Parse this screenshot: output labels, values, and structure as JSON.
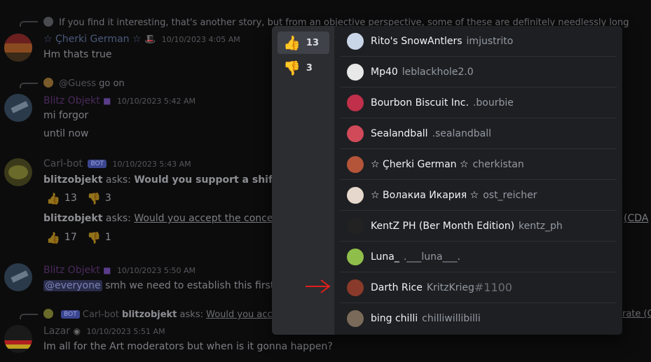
{
  "chat": {
    "top_reply": {
      "name": "",
      "text": "If you find it interesting, that's another story, but from an objective perspective, some of these are definitely needlessly long"
    },
    "msg1": {
      "name": "☆ Çherki German ☆",
      "time": "10/10/2023 4:05 AM",
      "text": "Hm thats true"
    },
    "reply2": {
      "name": "@Guess",
      "text": "go on"
    },
    "msg2": {
      "name": "Blitz Objekt",
      "time": "10/10/2023 5:42 AM",
      "line1": "mi forgor",
      "line2": "until now"
    },
    "msg3": {
      "name": "Carl-bot",
      "badge": "BOT",
      "time": "10/10/2023 5:43 AM",
      "poll1_user": "blitzobjekt",
      "poll1_asks": "asks:",
      "poll1_q": "Would you support a shift to u",
      "poll1_up": "13",
      "poll1_down": "3",
      "poll2_user": "blitzobjekt",
      "poll2_asks": "asks:",
      "poll2_q": "Would you accept the concept",
      "poll2_tail": "(CDA",
      "poll2_up": "17",
      "poll2_down": "1"
    },
    "msg4": {
      "name": "Blitz Objekt",
      "time": "10/10/2023 5:50 AM",
      "mention": "@everyone",
      "text": "smh we need to establish this first"
    },
    "reply5": {
      "badge": "BOT",
      "name": "Carl-bot",
      "user": "blitzobjekt",
      "asks": "asks:",
      "q": "Would you acce",
      "tail": "rate (C"
    },
    "msg5": {
      "name": "Lazar",
      "time": "10/10/2023 5:51 AM",
      "text": "Im all for the Art moderators but when is it gonna happen?"
    }
  },
  "popup": {
    "tabs": [
      {
        "emoji": "👍",
        "count": "13",
        "active": true
      },
      {
        "emoji": "👎",
        "count": "3",
        "active": false
      }
    ],
    "users": [
      {
        "name": "Rito's SnowAntlers",
        "handle": "imjustrito",
        "disc": "",
        "color": "#c9d6e8"
      },
      {
        "name": "Mp40",
        "handle": "leblackhole2.0",
        "disc": "",
        "color": "#e8e8e8"
      },
      {
        "name": "Bourbon Biscuit Inc.",
        "handle": ".bourbie",
        "disc": "",
        "color": "#c0304a"
      },
      {
        "name": "Sealandball",
        "handle": ".sealandball",
        "disc": "",
        "color": "#d14a5a"
      },
      {
        "name": "☆ Çherki German ☆",
        "handle": "cherkistan",
        "disc": "",
        "color": "#b4553a"
      },
      {
        "name": "☆ Волакиа Икария ☆",
        "handle": "ost_reicher",
        "disc": "",
        "color": "#e6d8cc"
      },
      {
        "name": "KentZ PH (Ber Month Edition)",
        "handle": "kentz_ph",
        "disc": "",
        "color": "#222222"
      },
      {
        "name": "Luna_",
        "handle": ".___luna___.",
        "disc": "",
        "color": "#8fbf4a"
      },
      {
        "name": "Darth Rice",
        "handle": "KritzKrieg",
        "disc": "#1100",
        "color": "#8a3a2a"
      },
      {
        "name": "bing chilli",
        "handle": "chilliwillibilli",
        "disc": "",
        "color": "#7a6a5a"
      }
    ]
  }
}
